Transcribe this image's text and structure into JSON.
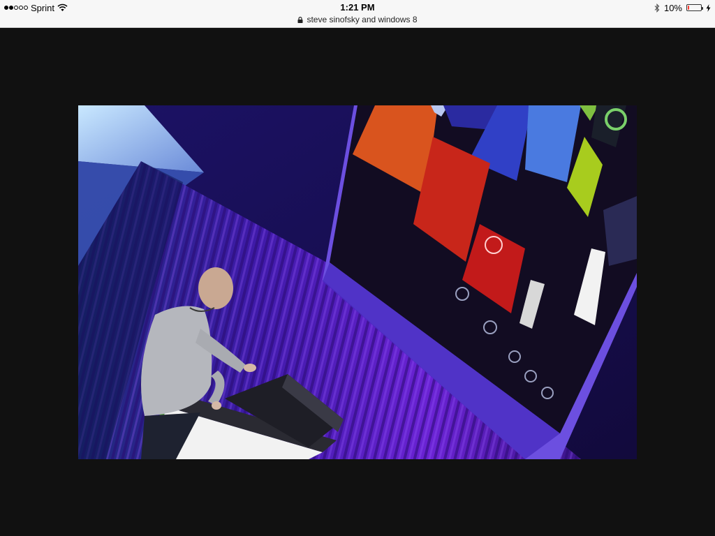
{
  "status_bar": {
    "carrier": "Sprint",
    "signal_bars_filled": 2,
    "signal_bars_total": 5,
    "time": "1:21 PM",
    "page_title": "steve sinofsky and windows 8",
    "battery_percent": "10%",
    "battery_level": 0.1,
    "icons": [
      "wifi-icon",
      "lock-icon",
      "bluetooth-icon",
      "battery-icon",
      "charging-bolt-icon"
    ]
  },
  "colors": {
    "background": "#111111",
    "status_bar": "#f7f7f7",
    "battery_low": "#ff3b30",
    "tile_orange": "#d9541e",
    "tile_red": "#c8261a",
    "tile_lime": "#a8cc1e",
    "curtain_purple": "#5b1fc4"
  },
  "photo": {
    "subject": "man-at-podium-presenting-large-screen"
  }
}
